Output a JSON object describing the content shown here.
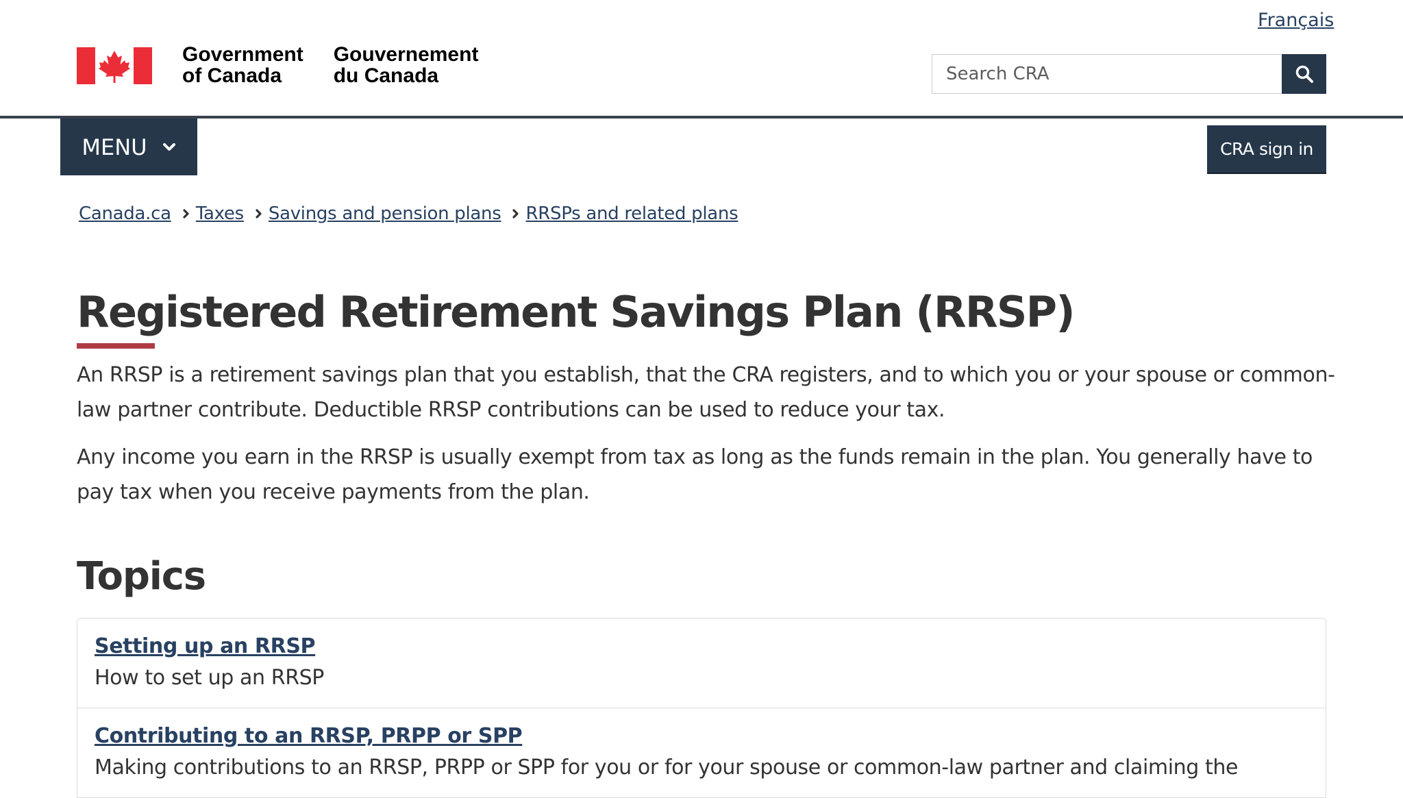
{
  "header": {
    "language_link": "Français",
    "gov_name_en": "Government\nof Canada",
    "gov_name_fr": "Gouvernement\ndu Canada",
    "search": {
      "placeholder": "Search CRA",
      "value": ""
    }
  },
  "nav": {
    "menu_label": "MENU",
    "signin_label": "CRA sign in"
  },
  "breadcrumb": [
    {
      "label": "Canada.ca"
    },
    {
      "label": "Taxes"
    },
    {
      "label": "Savings and pension plans"
    },
    {
      "label": "RRSPs and related plans"
    }
  ],
  "main": {
    "title": "Registered Retirement Savings Plan (RRSP)",
    "intro": [
      "An RRSP is a retirement savings plan that you establish, that the CRA registers, and to which you or your spouse or common-law partner contribute. Deductible RRSP contributions can be used to reduce your tax.",
      "Any income you earn in the RRSP is usually exempt from tax as long as the funds remain in the plan. You generally have to pay tax when you receive payments from the plan."
    ],
    "topics_heading": "Topics",
    "topics": [
      {
        "title": "Setting up an RRSP",
        "description": "How to set up an RRSP"
      },
      {
        "title": "Contributing to an RRSP, PRPP or SPP",
        "description": "Making contributions to an RRSP, PRPP or SPP for you or for your spouse or common-law partner and claiming the"
      }
    ]
  },
  "colors": {
    "brand_dark": "#26374a",
    "link": "#284162",
    "title_accent": "#af3c43",
    "flag_red": "#eb2d37"
  },
  "icons": {
    "flag": "canada-flag-icon",
    "search": "search-icon",
    "menu": "chevron-down-icon",
    "breadcrumb_separator": "chevron-right-icon"
  }
}
